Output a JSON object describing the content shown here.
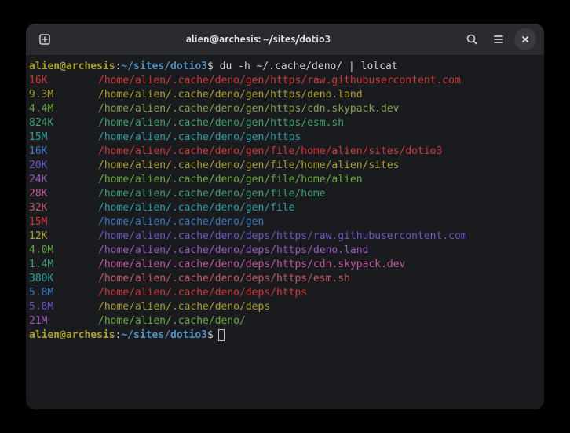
{
  "window": {
    "title": "alien@archesis: ~/sites/dotio3"
  },
  "prompt": {
    "user_host": "alien@archesis",
    "colon": ":",
    "path": "~/sites/dotio3",
    "dollar": "$"
  },
  "command": " du -h ~/.cache/deno/ | lolcat",
  "rows": [
    {
      "size": "16K",
      "path": "/home/alien/.cache/deno/gen/https/raw.githubusercontent.com",
      "sizeColor": "#cc3a3a",
      "pathColor": "#cc3a3a"
    },
    {
      "size": "9.3M",
      "path": "/home/alien/.cache/deno/gen/https/deno.land",
      "sizeColor": "#a8a030",
      "pathColor": "#a8a030"
    },
    {
      "size": "4.4M",
      "path": "/home/alien/.cache/deno/gen/https/cdn.skypack.dev",
      "sizeColor": "#6aaa40",
      "pathColor": "#8aa050"
    },
    {
      "size": "824K",
      "path": "/home/alien/.cache/deno/gen/https/esm.sh",
      "sizeColor": "#40a070",
      "pathColor": "#40a070"
    },
    {
      "size": "15M",
      "path": "/home/alien/.cache/deno/gen/https",
      "sizeColor": "#30a0a0",
      "pathColor": "#30a0a0"
    },
    {
      "size": "16K",
      "path": "/home/alien/.cache/deno/gen/file/home/alien/sites/dotio3",
      "sizeColor": "#3a7ac0",
      "pathColor": "#cc3a3a"
    },
    {
      "size": "20K",
      "path": "/home/alien/.cache/deno/gen/file/home/alien/sites",
      "sizeColor": "#6a5ac0",
      "pathColor": "#a8a030"
    },
    {
      "size": "24K",
      "path": "/home/alien/.cache/deno/gen/file/home/alien",
      "sizeColor": "#9a5ac0",
      "pathColor": "#6aaa40"
    },
    {
      "size": "28K",
      "path": "/home/alien/.cache/deno/gen/file/home",
      "sizeColor": "#c05a9a",
      "pathColor": "#40a070"
    },
    {
      "size": "32K",
      "path": "/home/alien/.cache/deno/gen/file",
      "sizeColor": "#c05a6a",
      "pathColor": "#30a0a0"
    },
    {
      "size": "15M",
      "path": "/home/alien/.cache/deno/gen",
      "sizeColor": "#cc3a3a",
      "pathColor": "#3a7ac0"
    },
    {
      "size": "12K",
      "path": "/home/alien/.cache/deno/deps/https/raw.githubusercontent.com",
      "sizeColor": "#a8a030",
      "pathColor": "#6a5ac0"
    },
    {
      "size": "4.0M",
      "path": "/home/alien/.cache/deno/deps/https/deno.land",
      "sizeColor": "#6aaa40",
      "pathColor": "#9a5ac0"
    },
    {
      "size": "1.4M",
      "path": "/home/alien/.cache/deno/deps/https/cdn.skypack.dev",
      "sizeColor": "#40a070",
      "pathColor": "#c05a9a"
    },
    {
      "size": "380K",
      "path": "/home/alien/.cache/deno/deps/https/esm.sh",
      "sizeColor": "#30a0a0",
      "pathColor": "#c05a6a"
    },
    {
      "size": "5.8M",
      "path": "/home/alien/.cache/deno/deps/https",
      "sizeColor": "#3a7ac0",
      "pathColor": "#cc3a3a"
    },
    {
      "size": "5.8M",
      "path": "/home/alien/.cache/deno/deps",
      "sizeColor": "#6a5ac0",
      "pathColor": "#a8a030"
    },
    {
      "size": "21M",
      "path": "/home/alien/.cache/deno/",
      "sizeColor": "#9a5ac0",
      "pathColor": "#6aaa40"
    }
  ]
}
